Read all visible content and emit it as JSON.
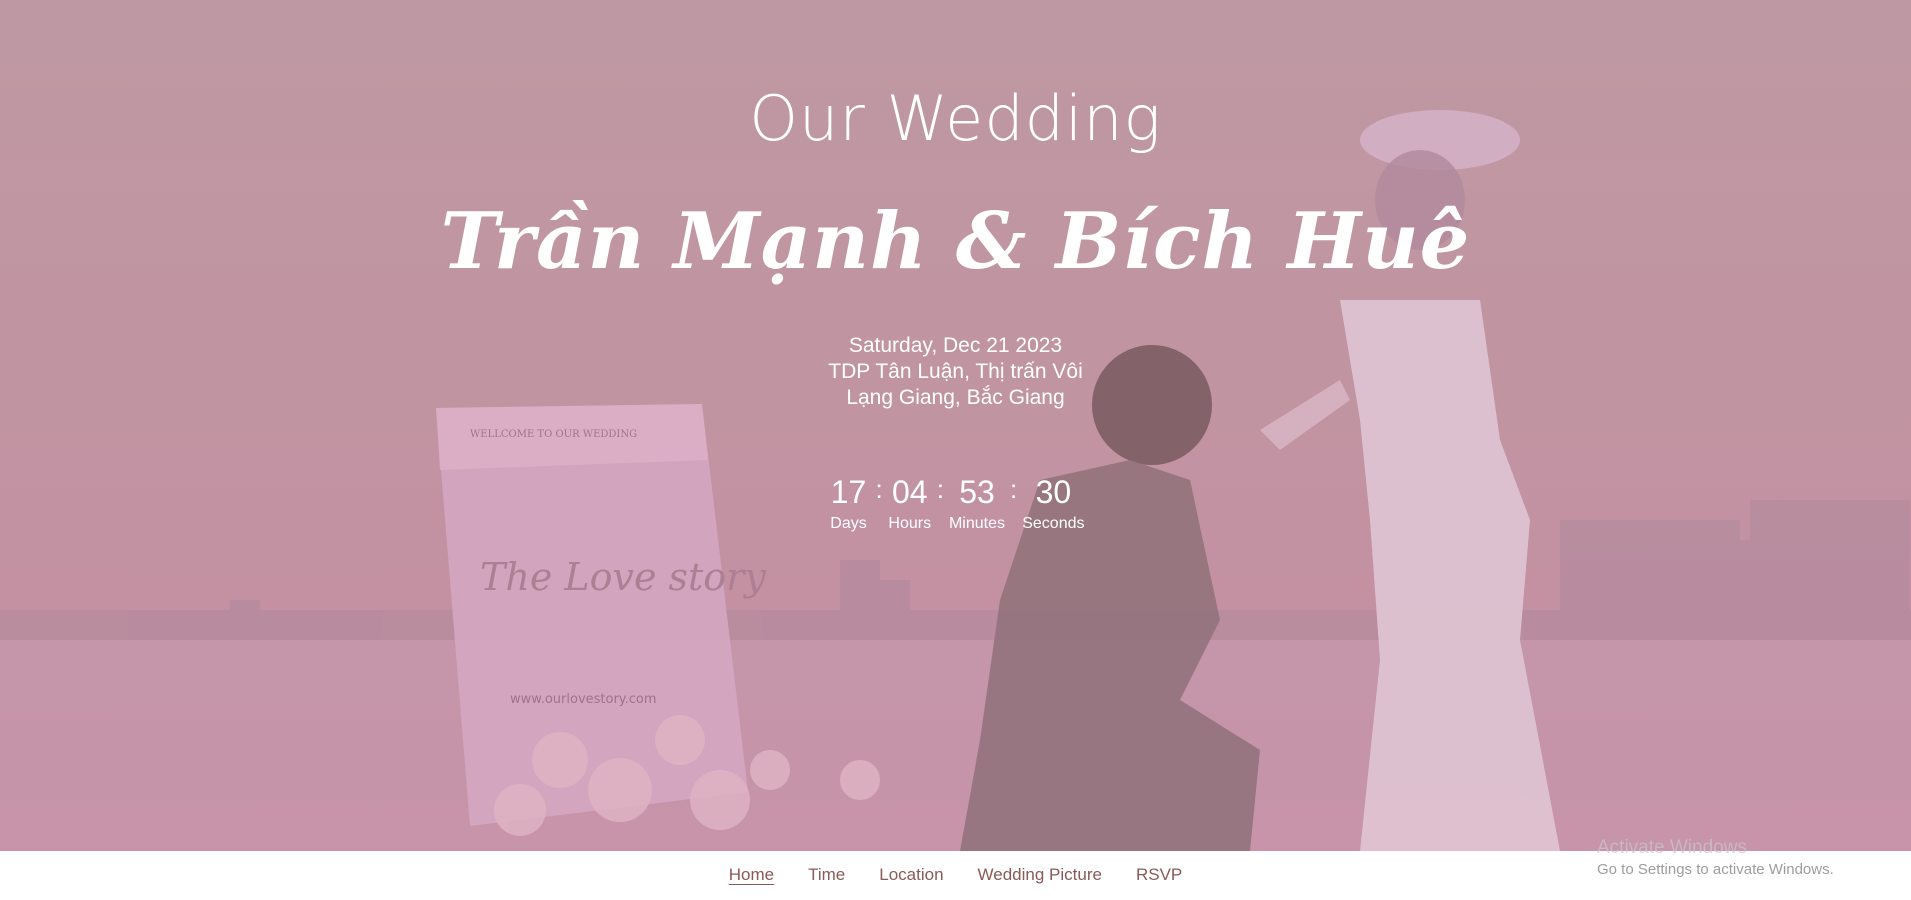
{
  "hero": {
    "title": "Our Wedding",
    "names": "Trần Mạnh & Bích Huê",
    "date": "Saturday, Dec 21 2023",
    "address_line1": "TDP Tân Luận, Thị trấn Vôi",
    "address_line2": "Lạng Giang, Bắc Giang"
  },
  "countdown": {
    "days": "17",
    "hours": "04",
    "minutes": "53",
    "seconds": "30",
    "days_label": "Days",
    "hours_label": "Hours",
    "minutes_label": "Minutes",
    "seconds_label": "Seconds",
    "separator": ":"
  },
  "nav": {
    "items": [
      {
        "label": "Home",
        "active": true
      },
      {
        "label": "Time",
        "active": false
      },
      {
        "label": "Location",
        "active": false
      },
      {
        "label": "Wedding Picture",
        "active": false
      },
      {
        "label": "RSVP",
        "active": false
      }
    ]
  },
  "sign": {
    "welcome": "WELLCOME TO OUR WEDDING",
    "script": "The Love story",
    "url": "www.ourlovestory.com"
  },
  "watermark": {
    "line1": "Activate Windows",
    "line2": "Go to Settings to activate Windows."
  },
  "colors": {
    "overlay": "#c48ea1",
    "nav_text": "#8a5a58",
    "accent": "#ffffff"
  }
}
